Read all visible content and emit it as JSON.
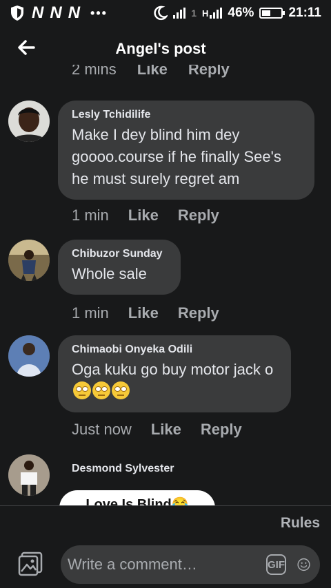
{
  "status_bar": {
    "carrier_marks": [
      "N",
      "N",
      "N"
    ],
    "dots": "•••",
    "battery_percent": "46%",
    "battery_level": 0.46,
    "time": "21:11",
    "network_1": "1",
    "network_2": "H"
  },
  "header": {
    "title": "Angel's post",
    "back_icon": "arrow-left-icon"
  },
  "partial_actions": {
    "time": "2 mins",
    "like": "Like",
    "reply": "Reply"
  },
  "comments": [
    {
      "author": "Lesly Tchidilife",
      "text": "Make I dey blind him dey goooo.course if he finally See's he must surely regret am",
      "time": "1 min",
      "like": "Like",
      "reply": "Reply"
    },
    {
      "author": "Chibuzor Sunday",
      "text": "Whole sale",
      "time": "1 min",
      "like": "Like",
      "reply": "Reply"
    },
    {
      "author": "Chimaobi Onyeka Odili",
      "text": "Oga kuku go buy motor jack o",
      "emoji_count": 3,
      "emoji_icon": "rolling-eyes-emoji",
      "time": "Just now",
      "like": "Like",
      "reply": "Reply"
    },
    {
      "author": "Desmond Sylvester",
      "attachment_text": "Love Is Blind😂"
    }
  ],
  "footer": {
    "rules_label": "Rules",
    "comment_placeholder": "Write a comment…",
    "gif_label": "GIF",
    "photo_icon": "photo-icon",
    "emoji_icon": "smiley-icon"
  },
  "colors": {
    "background": "#18191a",
    "bubble": "#3a3b3c",
    "text_primary": "#e4e6eb",
    "text_secondary": "#a8abaf"
  }
}
